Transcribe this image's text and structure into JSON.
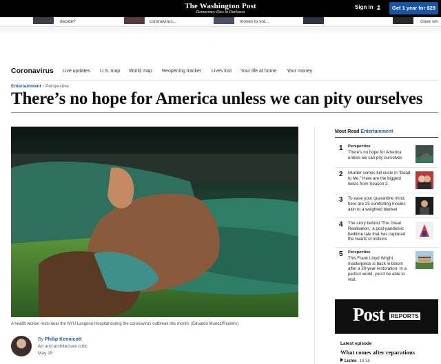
{
  "masthead": {
    "logo": "The Washington Post",
    "tagline": "Democracy Dies in Darkness",
    "signin_label": "Sign in",
    "subscribe_label": "Get 1 year for $29"
  },
  "promo_strip": [
    "decide?",
    "coronavirus...",
    "moves to vot...",
    "close sm"
  ],
  "section_nav": {
    "title": "Coronavirus",
    "links": [
      "Live updates",
      "U.S. map",
      "World map",
      "Reopening tracker",
      "Lives lost",
      "Your life at home",
      "Your money"
    ]
  },
  "article": {
    "kicker_section": "Entertainment",
    "kicker_label": "Perspective",
    "headline": "There’s no hope for America unless we can pity ourselves",
    "caption": "A health worker rests near the NYU Langone Hospital during the coronavirus outbreak this month. (Eduardo Munoz/Reuters)",
    "byline_prefix": "By",
    "author": "Philip Kennicott",
    "author_role": "Art and architecture critic",
    "date": "May 15"
  },
  "sidebar": {
    "most_read_label": "Most Read",
    "most_read_section": "Entertainment",
    "items": [
      {
        "num": "1",
        "tag": "Perspective",
        "text": "There’s no hope for America unless we can pity ourselves"
      },
      {
        "num": "2",
        "tag": "",
        "text": "Murder comes full circle in “Dead to Me.” Here are the biggest twists from Season 2."
      },
      {
        "num": "3",
        "tag": "",
        "text": "To ease your quarantine mind, here are 25 comforting movies akin to a weighted blanket"
      },
      {
        "num": "4",
        "tag": "",
        "text": "The story behind ‘The Great Realisation,’ a post-pandemic bedtime tale that has captured the hearts of millions"
      },
      {
        "num": "5",
        "tag": "Perspective",
        "text": "This Frank Lloyd Wright masterpiece is back in bloom after a 20-year restoration. In a perfect world, you’d be able to visit."
      }
    ],
    "podcast": {
      "brand_word": "Post",
      "brand_badge": "REPORTS",
      "latest_label": "Latest episode",
      "latest_title": "What comes after reparations",
      "listen_label": "Listen",
      "listen_time": "19:16"
    }
  },
  "colors": {
    "accent": "#1955a5",
    "masthead": "#000000"
  }
}
